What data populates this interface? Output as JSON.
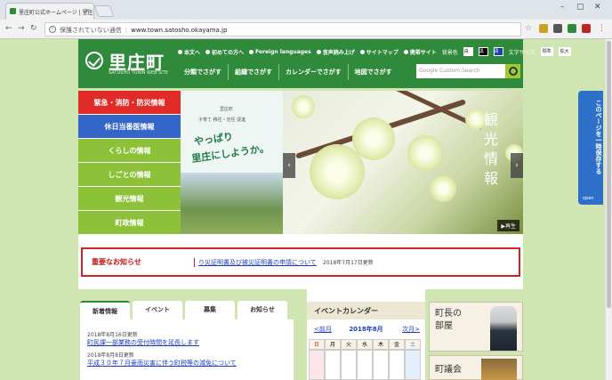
{
  "browser": {
    "tab_title": "里庄町公式ホームページ | 里庄",
    "address_security": "保護されていない通信",
    "address_url": "www.town.satosho.okayama.jp"
  },
  "header": {
    "site_name": "里庄町",
    "site_sub": "SATOSHO TOWN WEB SITE",
    "util_links": [
      "本文へ",
      "初めての方へ",
      "Foreign languages",
      "音声読み上げ",
      "サイトマップ",
      "携帯サイト"
    ],
    "color_label": "背景色",
    "color_options": [
      "白",
      "黒",
      "青"
    ],
    "size_label": "文字サイズ",
    "size_options": [
      "標準",
      "拡大"
    ],
    "main_nav": [
      "分類でさがす",
      "組織でさがす",
      "カレンダーでさがす",
      "地図でさがす"
    ],
    "search_placeholder": "Custom Search",
    "search_brand": "Google"
  },
  "side_menu": [
    {
      "label": "緊急・消防・防災情報",
      "color": "#e02b27"
    },
    {
      "label": "休日当番医情報",
      "color": "#3465c9"
    },
    {
      "label": "くらしの情報",
      "color": "#8dc13a"
    },
    {
      "label": "しごとの情報",
      "color": "#8dc13a"
    },
    {
      "label": "観光情報",
      "color": "#8dc13a"
    },
    {
      "label": "町政情報",
      "color": "#8dc13a"
    }
  ],
  "hero": {
    "banner_line1": "里庄町",
    "banner_line2": "子育て 移住・定住 促進",
    "banner_line3": "やっぱり",
    "banner_line4": "里庄にしようか。",
    "photo_caption": "観光情報",
    "play_label": "▶再生"
  },
  "side_tab": {
    "label": "このページを一時保存する",
    "open": "open"
  },
  "notice": {
    "title": "重要なお知らせ",
    "link": "り災証明書及び被災証明書の申請について",
    "date": "2018年7月17日更新"
  },
  "news": {
    "tabs": [
      "新着情報",
      "イベント",
      "募集",
      "お知らせ"
    ],
    "items": [
      {
        "date": "2018年8月16日更新",
        "title": "町民課一部業務の受付時間を延長します"
      },
      {
        "date": "2018年8月8日更新",
        "title": "平成３０年７月豪雨災害に伴う町税等の減免について"
      }
    ]
  },
  "calendar": {
    "title": "イベントカレンダー",
    "prev": "<前月",
    "month": "2018年8月",
    "next": "次月>",
    "weekdays": [
      "日",
      "月",
      "火",
      "水",
      "木",
      "金",
      "土"
    ]
  },
  "mayor": {
    "line1": "町長の",
    "line2": "部屋"
  },
  "council": {
    "label": "町議会"
  }
}
